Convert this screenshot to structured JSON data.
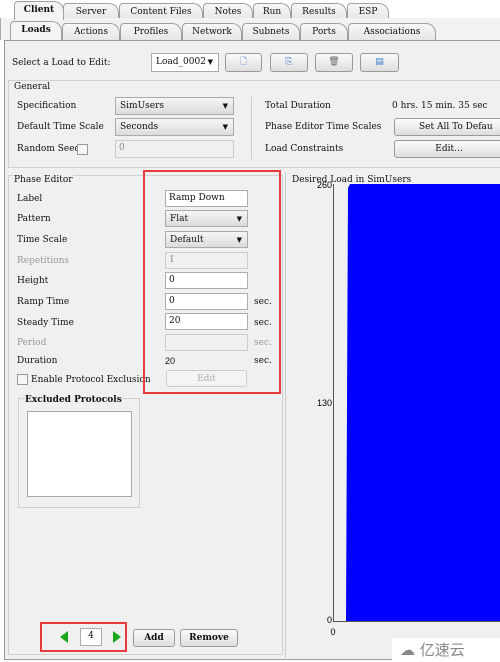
{
  "top_tabs": [
    "Client",
    "Server",
    "Content Files",
    "Notes",
    "Run",
    "Results",
    "ESP"
  ],
  "sub_tabs": [
    "Loads",
    "Actions",
    "Profiles",
    "Network",
    "Subnets",
    "Ports",
    "Associations"
  ],
  "load_select": {
    "label": "Select a Load to Edit:",
    "value": "Load_0002"
  },
  "toolbar_icons": [
    "new-load-icon",
    "copy-load-icon",
    "delete-load-icon",
    "properties-icon"
  ],
  "general": {
    "title": "General",
    "specification_label": "Specification",
    "specification_value": "SimUsers",
    "time_scale_label": "Default Time Scale",
    "time_scale_value": "Seconds",
    "random_seed_label": "Random Seed",
    "random_seed_value": "0",
    "total_duration_label": "Total Duration",
    "total_duration_value": "0 hrs. 15 min. 35 sec",
    "phase_time_scales_label": "Phase Editor Time Scales",
    "set_all_label": "Set All To Defau",
    "constraints_label": "Load Constraints",
    "edit_label": "Edit..."
  },
  "phase_editor": {
    "title": "Phase Editor",
    "label_label": "Label",
    "label_value": "Ramp Down",
    "pattern_label": "Pattern",
    "pattern_value": "Flat",
    "time_scale_label": "Time Scale",
    "time_scale_value": "Default",
    "repetitions_label": "Repetitions",
    "repetitions_value": "1",
    "height_label": "Height",
    "height_value": "0",
    "ramp_label": "Ramp Time",
    "ramp_value": "0",
    "steady_label": "Steady Time",
    "steady_value": "20",
    "period_label": "Period",
    "period_value": "",
    "duration_label": "Duration",
    "duration_value": "20",
    "unit": "sec.",
    "exclusion_label": "Enable Protocol Exclusion",
    "exclusion_edit": "Edit",
    "excluded_title": "Excluded Protocols"
  },
  "nav": {
    "phase_index": "4",
    "add_label": "Add",
    "remove_label": "Remove"
  },
  "chart_data": {
    "type": "area",
    "title": "Desired Load in SimUsers",
    "y_ticks": [
      "260",
      "130",
      "0"
    ],
    "x_ticks": [
      "0"
    ],
    "ylim": [
      0,
      260
    ],
    "color": "#0000ff"
  },
  "watermark": "亿速云"
}
